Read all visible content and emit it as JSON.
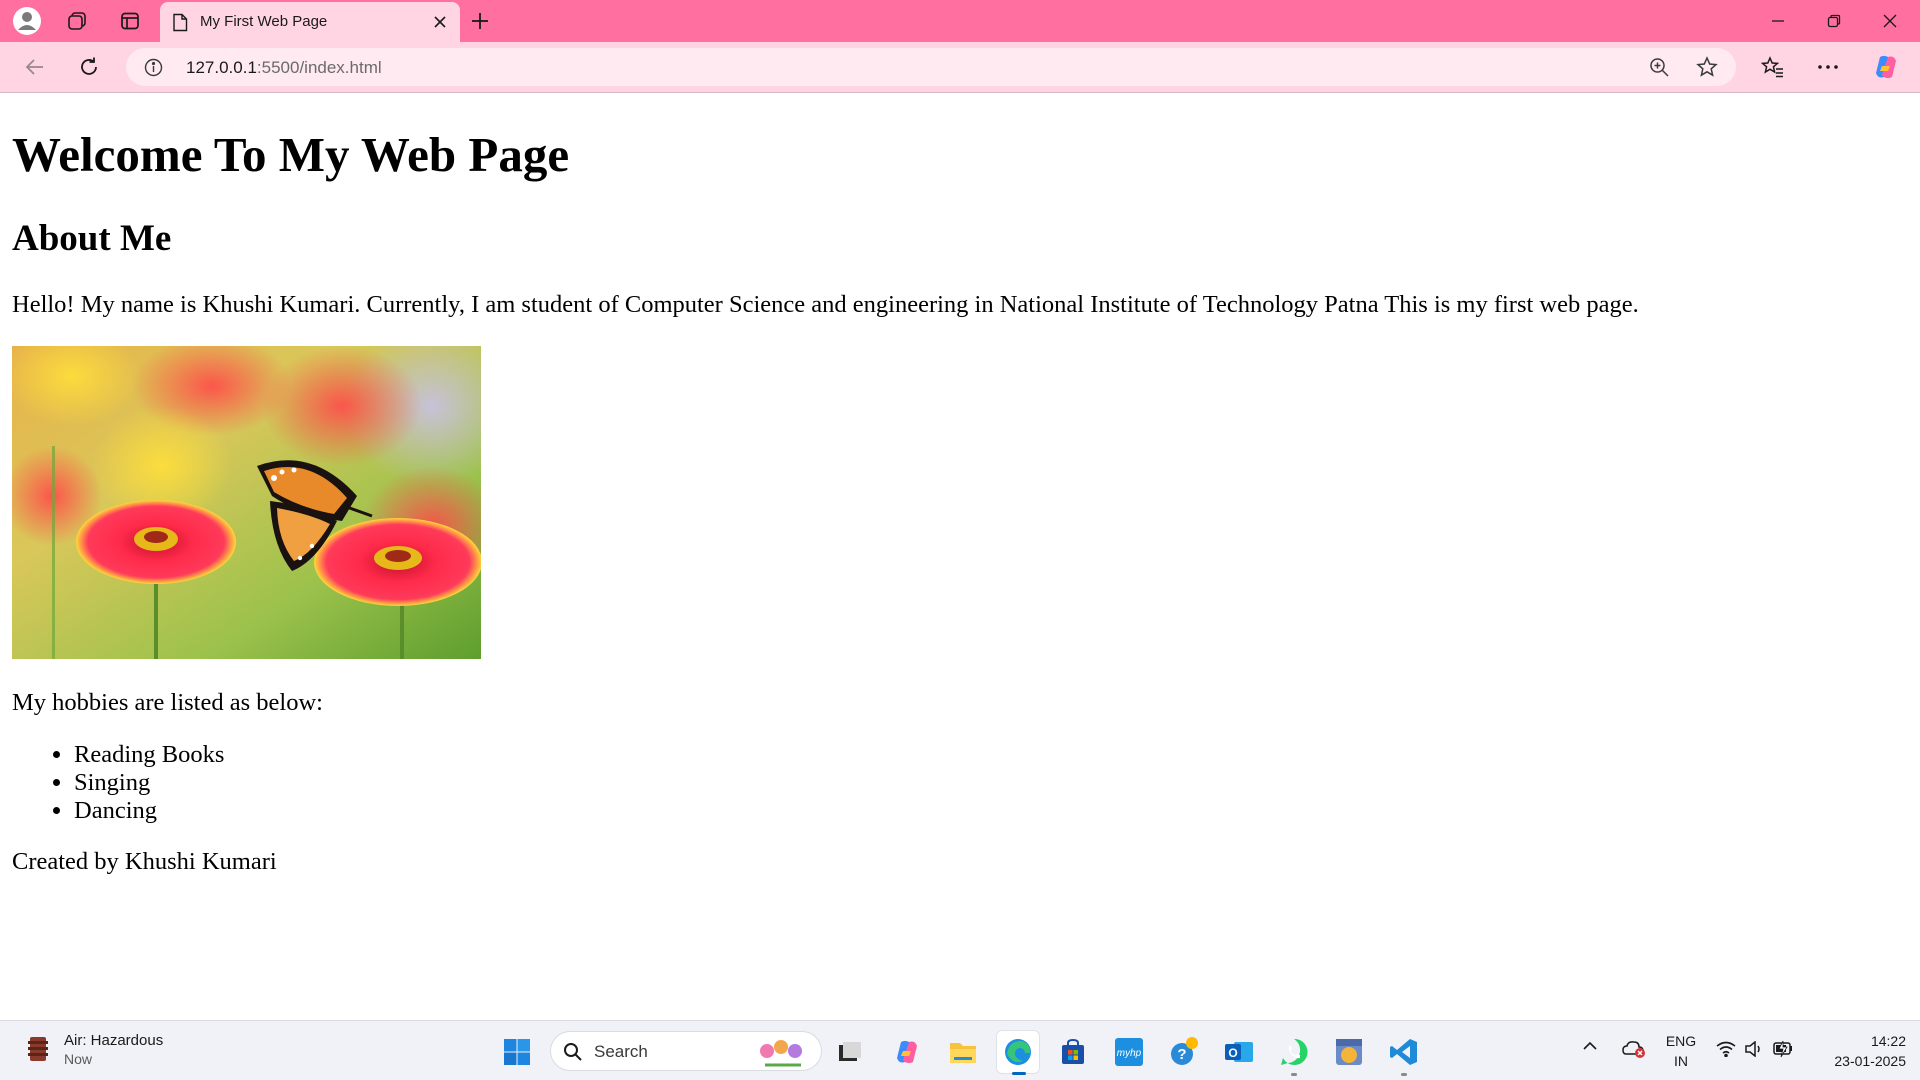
{
  "browser": {
    "tab": {
      "title": "My First Web Page"
    },
    "address": {
      "host": "127.0.0.1",
      "path": ":5500/index.html"
    },
    "colors": {
      "frame": "#ff6fa0",
      "toolbar": "#ffd4e3"
    }
  },
  "page": {
    "heading": "Welcome To My Web Page",
    "subheading": "About Me",
    "intro": "Hello! My name is Khushi Kumari. Currently, I am student of Computer Science and engineering in National Institute of Technology Patna This is my first web page.",
    "image_subject": "butterfly-on-flowers",
    "hobbies_intro": "My hobbies are listed as below:",
    "hobbies": [
      "Reading Books",
      "Singing",
      "Dancing"
    ],
    "footer": "Created by Khushi Kumari"
  },
  "taskbar": {
    "weather": {
      "title": "Air: Hazardous",
      "sub": "Now"
    },
    "search_label": "Search",
    "apps": [
      "start",
      "search",
      "task-view",
      "copilot",
      "file-explorer",
      "edge",
      "store",
      "myhp",
      "help",
      "outlook",
      "whatsapp",
      "photos",
      "vscode"
    ],
    "language": {
      "line1": "ENG",
      "line2": "IN"
    },
    "clock": {
      "time": "14:22",
      "date": "23-01-2025"
    }
  }
}
